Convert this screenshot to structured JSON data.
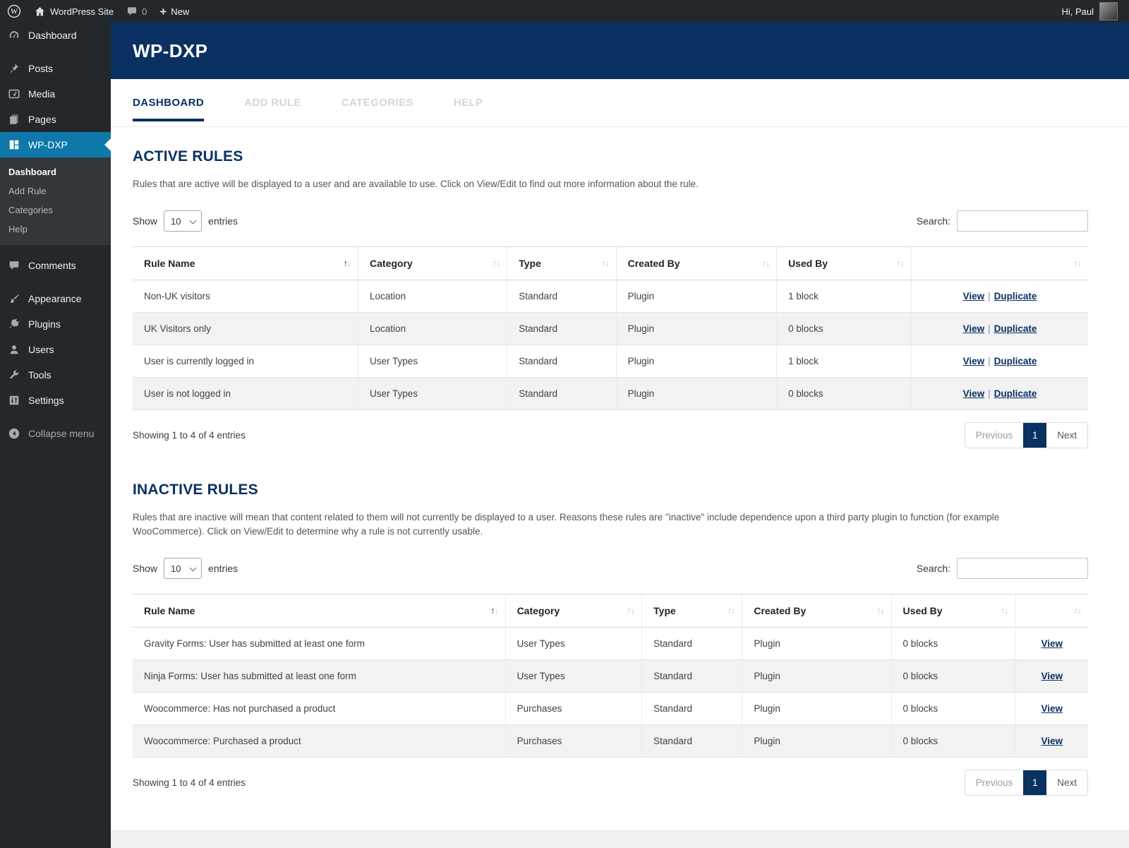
{
  "colors": {
    "accent_navy": "#0a3161",
    "active_menu_blue": "#0e78ab",
    "admin_bar_bg": "#23282d",
    "link": "#0a3161"
  },
  "admin_bar": {
    "site_name": "WordPress Site",
    "comment_count": "0",
    "new_label": "New",
    "greeting": "Hi, Paul"
  },
  "sidebar": {
    "items": [
      {
        "id": "dashboard",
        "label": "Dashboard"
      },
      {
        "id": "posts",
        "label": "Posts"
      },
      {
        "id": "media",
        "label": "Media"
      },
      {
        "id": "pages",
        "label": "Pages"
      },
      {
        "id": "wp-dxp",
        "label": "WP-DXP"
      },
      {
        "id": "comments",
        "label": "Comments"
      },
      {
        "id": "appearance",
        "label": "Appearance"
      },
      {
        "id": "plugins",
        "label": "Plugins"
      },
      {
        "id": "users",
        "label": "Users"
      },
      {
        "id": "tools",
        "label": "Tools"
      },
      {
        "id": "settings",
        "label": "Settings"
      },
      {
        "id": "collapse",
        "label": "Collapse menu"
      }
    ],
    "wp_dxp_submenu": [
      {
        "label": "Dashboard",
        "active": true
      },
      {
        "label": "Add Rule",
        "active": false
      },
      {
        "label": "Categories",
        "active": false
      },
      {
        "label": "Help",
        "active": false
      }
    ]
  },
  "page_header": {
    "title": "WP-DXP"
  },
  "tabs": [
    {
      "label": "DASHBOARD",
      "active": true
    },
    {
      "label": "ADD RULE",
      "active": false
    },
    {
      "label": "CATEGORIES",
      "active": false
    },
    {
      "label": "HELP",
      "active": false
    }
  ],
  "active_rules": {
    "title": "ACTIVE RULES",
    "description": "Rules that are active will be displayed to a user and are available to use. Click on View/Edit to find out more information about the rule.",
    "show_label": "Show",
    "page_size": "10",
    "entries_label": "entries",
    "search_label": "Search:",
    "columns": [
      "Rule Name",
      "Category",
      "Type",
      "Created By",
      "Used By"
    ],
    "rows": [
      {
        "name": "Non-UK visitors",
        "category": "Location",
        "type": "Standard",
        "created_by": "Plugin",
        "used_by": "1 block",
        "actions": [
          "View",
          "Duplicate"
        ]
      },
      {
        "name": "UK Visitors only",
        "category": "Location",
        "type": "Standard",
        "created_by": "Plugin",
        "used_by": "0 blocks",
        "actions": [
          "View",
          "Duplicate"
        ]
      },
      {
        "name": "User is currently logged in",
        "category": "User Types",
        "type": "Standard",
        "created_by": "Plugin",
        "used_by": "1 block",
        "actions": [
          "View",
          "Duplicate"
        ]
      },
      {
        "name": "User is not logged in",
        "category": "User Types",
        "type": "Standard",
        "created_by": "Plugin",
        "used_by": "0 blocks",
        "actions": [
          "View",
          "Duplicate"
        ]
      }
    ],
    "summary": "Showing 1 to 4 of 4 entries",
    "pagination": {
      "previous": "Previous",
      "current": "1",
      "next": "Next"
    }
  },
  "inactive_rules": {
    "title": "INACTIVE RULES",
    "description": "Rules that are inactive will mean that content related to them will not currently be displayed to a user. Reasons these rules are \"inactive\" include dependence upon a third party plugin to function (for example WooCommerce). Click on View/Edit to determine why a rule is not currently usable.",
    "show_label": "Show",
    "page_size": "10",
    "entries_label": "entries",
    "search_label": "Search:",
    "columns": [
      "Rule Name",
      "Category",
      "Type",
      "Created By",
      "Used By"
    ],
    "rows": [
      {
        "name": "Gravity Forms: User has submitted at least one form",
        "category": "User Types",
        "type": "Standard",
        "created_by": "Plugin",
        "used_by": "0 blocks",
        "actions": [
          "View"
        ]
      },
      {
        "name": "Ninja Forms: User has submitted at least one form",
        "category": "User Types",
        "type": "Standard",
        "created_by": "Plugin",
        "used_by": "0 blocks",
        "actions": [
          "View"
        ]
      },
      {
        "name": "Woocommerce: Has not purchased a product",
        "category": "Purchases",
        "type": "Standard",
        "created_by": "Plugin",
        "used_by": "0 blocks",
        "actions": [
          "View"
        ]
      },
      {
        "name": "Woocommerce: Purchased a product",
        "category": "Purchases",
        "type": "Standard",
        "created_by": "Plugin",
        "used_by": "0 blocks",
        "actions": [
          "View"
        ]
      }
    ],
    "summary": "Showing 1 to 4 of 4 entries",
    "pagination": {
      "previous": "Previous",
      "current": "1",
      "next": "Next"
    }
  }
}
